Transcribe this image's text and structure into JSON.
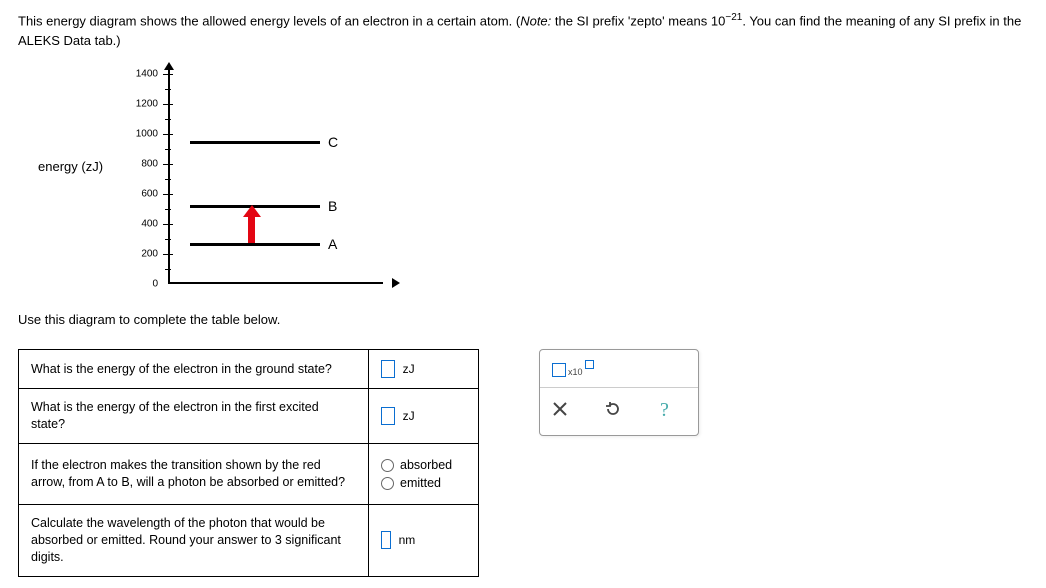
{
  "prompt": {
    "part1": "This energy diagram shows the allowed energy levels of an electron in a certain atom. (",
    "note_label": "Note:",
    "part2": " the SI prefix 'zepto' means ",
    "ten": "10",
    "exp": "−21",
    "part3": ". You can find the meaning of any SI prefix in the ALEKS Data tab.)"
  },
  "diagram": {
    "ylabel": "energy (zJ)",
    "ticks": [
      "1400",
      "1200",
      "1000",
      "800",
      "600",
      "400",
      "200",
      "0"
    ],
    "levels": {
      "C": "C",
      "B": "B",
      "A": "A"
    }
  },
  "instruction": "Use this diagram to complete the table below.",
  "table": {
    "q1": "What is the energy of the electron in the ground state?",
    "u1": "zJ",
    "q2": "What is the energy of the electron in the first excited state?",
    "u2": "zJ",
    "q3": "If the electron makes the transition shown by the red arrow, from A to B, will a photon be absorbed or emitted?",
    "r1": "absorbed",
    "r2": "emitted",
    "q4": "Calculate the wavelength of the photon that would be absorbed or emitted. Round your answer to 3 significant digits.",
    "u4": "nm"
  },
  "toolbox": {
    "x10": "x10"
  },
  "chart_data": {
    "type": "energy-level-diagram",
    "ylabel": "energy (zJ)",
    "ylim": [
      0,
      1400
    ],
    "yticks": [
      0,
      200,
      400,
      600,
      800,
      1000,
      1200,
      1400
    ],
    "levels": [
      {
        "name": "A",
        "energy": 275
      },
      {
        "name": "B",
        "energy": 525
      },
      {
        "name": "C",
        "energy": 950
      }
    ],
    "transition": {
      "from": "A",
      "to": "B",
      "direction": "up",
      "color": "red"
    }
  }
}
